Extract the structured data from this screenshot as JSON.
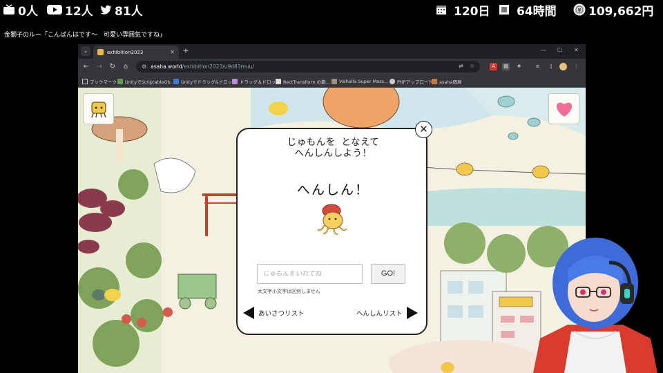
{
  "overlay": {
    "stats": [
      {
        "icon": "niconico-icon",
        "value": "0人"
      },
      {
        "icon": "youtube-icon",
        "value": "12人"
      },
      {
        "icon": "twitter-icon",
        "value": "81人"
      },
      {
        "icon": "calendar-icon",
        "value": "120日"
      },
      {
        "icon": "clock-icon",
        "value": "64時間"
      },
      {
        "icon": "coin-icon",
        "value": "109,662円"
      }
    ],
    "ticker": "金獅子のルー「こんばんはです～　可愛い雰囲気ですね」"
  },
  "browser": {
    "tab_title": "exhibition2023",
    "url_host": "asaha.world",
    "url_path": "/exhibition2023/u9d83muu/",
    "bookmarks": [
      {
        "label": "ブックマーク",
        "color": "#c8c8c8"
      },
      {
        "label": "UnityでScriptableOb...",
        "color": "#6a9955"
      },
      {
        "label": "Unityでドラッグ&ドロップ",
        "color": "#3d7bd9"
      },
      {
        "label": "ドラッグ＆ドロップ",
        "color": "#b78fd8"
      },
      {
        "label": "RectTransform の範...",
        "color": "#dddddd"
      },
      {
        "label": "Valhalla Super Mass...",
        "color": "#9a8f80"
      },
      {
        "label": "PHPアップロード",
        "color": "#cccccc"
      },
      {
        "label": "asaha個展",
        "color": "#c9773b"
      }
    ]
  },
  "page": {
    "modal": {
      "title_line1": "じゅもんを となえて",
      "title_line2": "へんしんしよう！",
      "result": "へんしん！",
      "input_placeholder": "じゅもんをいれてね",
      "go_label": "GO!",
      "note": "大文字小文字は区別しません",
      "prev_label": "あいさつリスト",
      "next_label": "へんしんリスト"
    }
  },
  "colors": {
    "heart": "#f06e93",
    "accent_yellow": "#f2c84b"
  }
}
